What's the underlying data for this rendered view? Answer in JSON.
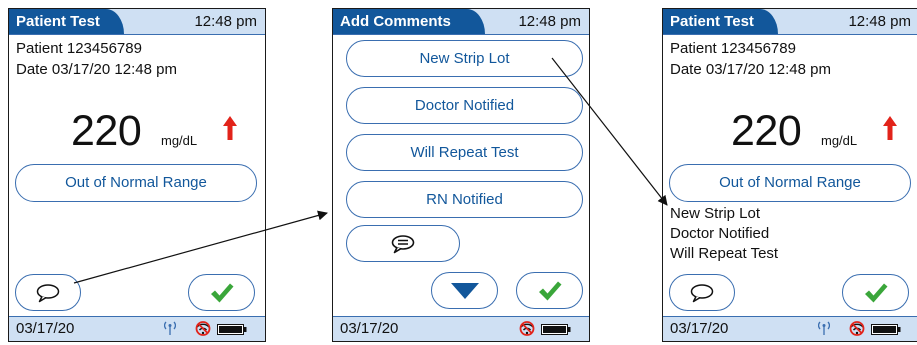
{
  "screens": [
    {
      "header": {
        "title": "Patient Test",
        "time": "12:48 pm"
      },
      "patient": "Patient 123456789",
      "date": "Date 03/17/20 12:48 pm",
      "result": {
        "value": "220",
        "unit": "mg/dL",
        "trend": "up"
      },
      "range_label": "Out of Normal Range",
      "footer": {
        "date": "03/17/20"
      }
    },
    {
      "header": {
        "title": "Add Comments",
        "time": "12:48 pm"
      },
      "options": [
        "New Strip Lot",
        "Doctor Notified",
        "Will Repeat Test",
        "RN Notified"
      ],
      "footer": {
        "date": "03/17/20"
      }
    },
    {
      "header": {
        "title": "Patient Test",
        "time": "12:48 pm"
      },
      "patient": "Patient 123456789",
      "date": "Date 03/17/20 12:48 pm",
      "result": {
        "value": "220",
        "unit": "mg/dL",
        "trend": "up"
      },
      "range_label": "Out of Normal Range",
      "comments": [
        "New Strip Lot",
        "Doctor Notified",
        "Will Repeat Test"
      ],
      "footer": {
        "date": "03/17/20"
      }
    }
  ],
  "colors": {
    "header_dark": "#12579b",
    "header_light": "#cfe0f3",
    "check_green": "#3aa63a",
    "trend_red": "#e2231a"
  },
  "icons": [
    "comment-icon",
    "checkmark-icon",
    "trend-up-arrow-icon",
    "down-arrow-icon",
    "antenna-icon",
    "no-wifi-icon",
    "battery-icon"
  ]
}
